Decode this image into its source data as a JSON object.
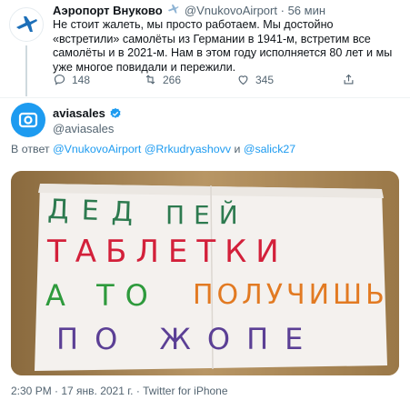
{
  "reply_tweet": {
    "name": "Аэропорт Внуково",
    "handle": "@VnukovoAirport",
    "separator": "·",
    "time": "56 мин",
    "text": "Не стоит жалеть, мы просто работаем. Мы достойно «встретили» самолёты из Германии в 1941-м, встретим все самолёты и в 2021-м. Нам в этом году исполняется 80 лет и мы уже многое повидали и пережили.",
    "replies": "148",
    "retweets": "266",
    "likes": "345"
  },
  "main_tweet": {
    "name": "aviasales",
    "handle": "@aviasales",
    "reply_prefix": "В ответ",
    "mention_1": "@VnukovoAirport",
    "mention_2": "@Rrkudryashovv",
    "conj": "и",
    "mention_3": "@salick27",
    "photo_lines": [
      "ДЕД ПЕЙ",
      "ТАБЛЕТКИ",
      "А ТО ПОЛУЧИШЬ",
      "ПО ЖОПЕ"
    ],
    "timestamp": "2:30 PM · 17 янв. 2021 г. · Twitter for iPhone"
  },
  "colors": {
    "accent": "#1d9bf0",
    "muted": "#536471"
  }
}
